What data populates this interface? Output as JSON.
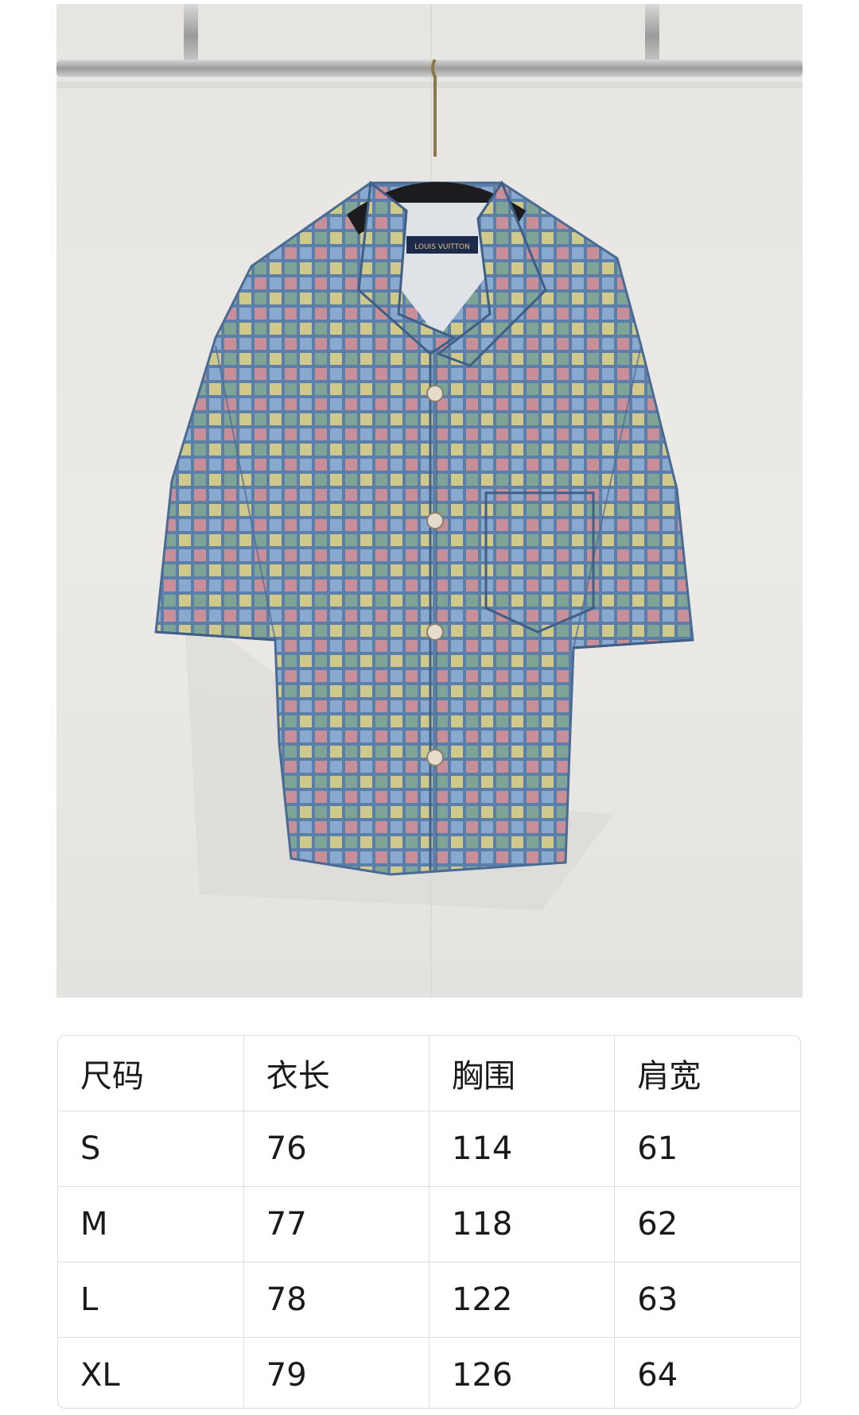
{
  "product_image": {
    "label_text": "LOUIS VUITTON",
    "colors": {
      "background_wall": "#e8e7e3",
      "rail": "#b9b9b9",
      "denim": "#5b7fa8",
      "check_blue": "#89a9cf",
      "check_pink": "#c98f98",
      "check_yellow": "#cfc98c",
      "check_green": "#7fa394",
      "hanger": "#1c1c1e",
      "buttons": "#e6dccb"
    }
  },
  "size_table": {
    "headers": [
      "尺码",
      "衣长",
      "胸围",
      "肩宽"
    ],
    "rows": [
      [
        "S",
        "76",
        "114",
        "61"
      ],
      [
        "M",
        "77",
        "118",
        "62"
      ],
      [
        "L",
        "78",
        "122",
        "63"
      ],
      [
        "XL",
        "79",
        "126",
        "64"
      ]
    ]
  }
}
